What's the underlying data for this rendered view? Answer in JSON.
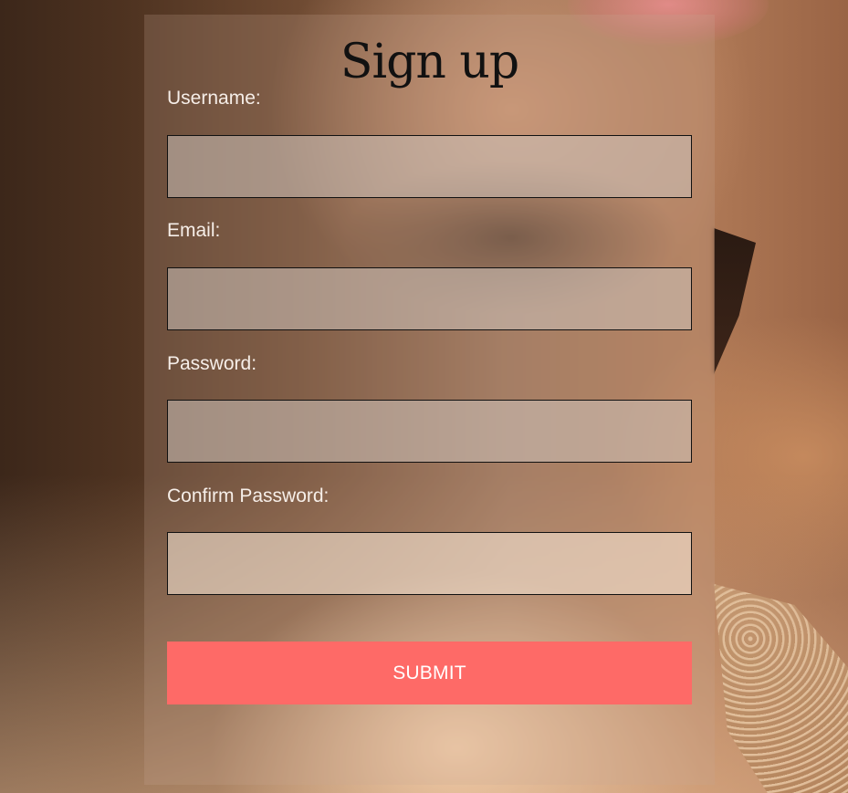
{
  "form": {
    "title": "Sign up",
    "username_label": "Username:",
    "username_value": "",
    "email_label": "Email:",
    "email_value": "",
    "password_label": "Password:",
    "password_value": "",
    "confirm_password_label": "Confirm Password:",
    "confirm_password_value": "",
    "submit_label": "SUBMIT"
  },
  "colors": {
    "submit_button": "#fe6a67",
    "title_text": "#111111",
    "label_text": "#f6eee8"
  }
}
